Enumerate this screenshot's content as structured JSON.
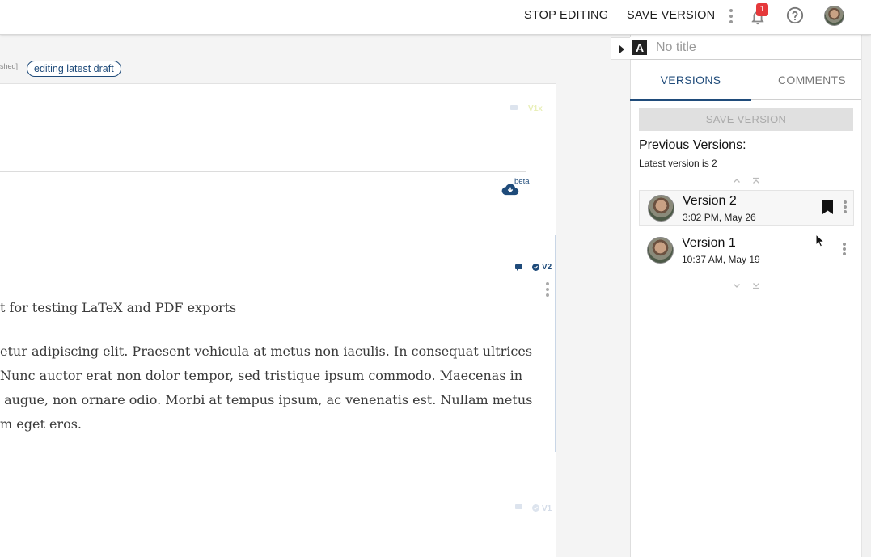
{
  "topbar": {
    "stop_editing": "STOP EDITING",
    "save_version": "SAVE VERSION",
    "notification_count": "1",
    "icons": [
      "more-icon",
      "bell-icon",
      "help-icon",
      "avatar"
    ]
  },
  "document": {
    "status_fragment": "shed]",
    "draft_pill": "editing latest draft",
    "beta_label": "beta",
    "block_labels": {
      "v2": "V2",
      "v1": "V1",
      "v1x": "V1x"
    },
    "heading_fragment": "t for testing LaTeX and PDF exports",
    "paragraph_lines": [
      "etur adipiscing elit. Praesent vehicula at metus non iaculis. In consequat ultrices",
      "Nunc auctor erat non dolor tempor, sed tristique ipsum commodo. Maecenas in",
      " augue, non ornare odio. Morbi at tempus ipsum, ac venenatis est. Nullam metus",
      "m eget eros."
    ]
  },
  "panel": {
    "title_placeholder": "No title",
    "tabs": [
      {
        "label": "VERSIONS",
        "active": true
      },
      {
        "label": "COMMENTS",
        "active": false
      }
    ],
    "save_version_disabled": "SAVE VERSION",
    "previous_versions_title": "Previous Versions:",
    "latest_version_text": "Latest version is 2",
    "versions": [
      {
        "name": "Version 2",
        "time": "3:02 PM, May 26",
        "bookmarked": true,
        "selected": true
      },
      {
        "name": "Version 1",
        "time": "10:37 AM, May 19",
        "bookmarked": false,
        "selected": false
      }
    ]
  },
  "colors": {
    "accent": "#1f4b7a",
    "badge": "#e5393b",
    "disabled_bg": "#e0e0e0",
    "disabled_text": "#aaaaaa"
  }
}
